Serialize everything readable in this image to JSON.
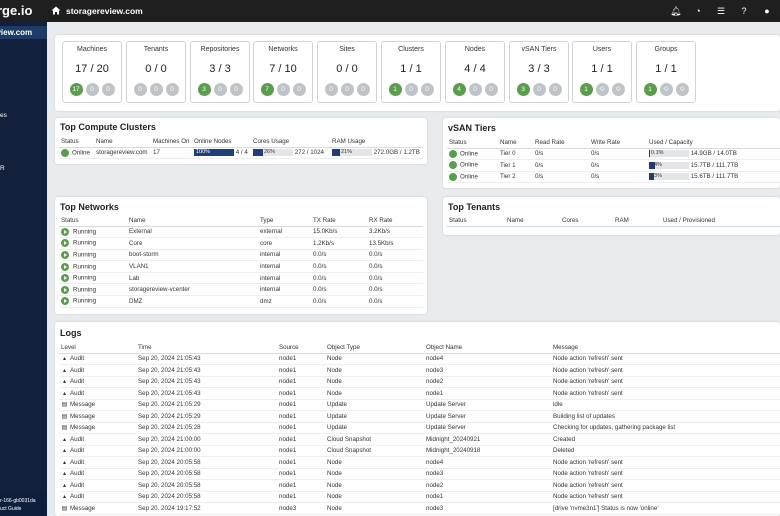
{
  "topbar": {
    "brand": "rge.io",
    "host": "storagereview.com",
    "icons": [
      "bell-icon",
      "rss-icon",
      "list-icon",
      "question-icon",
      "user-icon"
    ]
  },
  "sidebar": {
    "host": "eview.com",
    "frags": [
      "es",
      "R"
    ],
    "footer_line1": "r-166-gb0031da",
    "footer_line2": "uct Guide"
  },
  "stats": [
    {
      "label": "Machines",
      "value": "17 / 20",
      "counts": [
        "17",
        "0",
        "0"
      ]
    },
    {
      "label": "Tenants",
      "value": "0 / 0",
      "counts": [
        "0",
        "0",
        "0"
      ]
    },
    {
      "label": "Repositories",
      "value": "3 / 3",
      "counts": [
        "3",
        "0",
        "0"
      ]
    },
    {
      "label": "Networks",
      "value": "7 / 10",
      "counts": [
        "7",
        "0",
        "0"
      ]
    },
    {
      "label": "Sites",
      "value": "0 / 0",
      "counts": [
        "0",
        "0",
        "0"
      ]
    },
    {
      "label": "Clusters",
      "value": "1 / 1",
      "counts": [
        "1",
        "0",
        "0"
      ]
    },
    {
      "label": "Nodes",
      "value": "4 / 4",
      "counts": [
        "4",
        "0",
        "0"
      ]
    },
    {
      "label": "vSAN Tiers",
      "value": "3 / 3",
      "counts": [
        "3",
        "0",
        "0"
      ]
    },
    {
      "label": "Users",
      "value": "1 / 1",
      "counts": [
        "1",
        "0",
        "0"
      ]
    },
    {
      "label": "Groups",
      "value": "1 / 1",
      "counts": [
        "1",
        "0",
        "0"
      ]
    }
  ],
  "clusters": {
    "title": "Top Compute Clusters",
    "headers": [
      "Status",
      "Name",
      "Machines On",
      "Online Nodes",
      "Cores Usage",
      "RAM Usage"
    ],
    "rows": [
      {
        "status": "Online",
        "name": "storagereview.com",
        "machines_on": "17",
        "online_nodes_pct": "100%",
        "online_nodes_frac": 1.0,
        "online_nodes": "4 / 4",
        "cores_pct": "26%",
        "cores_frac": 0.26,
        "cores": "272 / 1024",
        "ram_pct": "21%",
        "ram_frac": 0.21,
        "ram": "272.0GB / 1.2TB"
      }
    ]
  },
  "vsan": {
    "title": "vSAN Tiers",
    "headers": [
      "Status",
      "Name",
      "Read Rate",
      "Write Rate",
      "Used / Capacity"
    ],
    "rows": [
      {
        "status": "Online",
        "name": "Tier 0",
        "read": "0/s",
        "write": "0/s",
        "pct": "0.1%",
        "frac": 0.001,
        "cap": "14.9GB / 14.0TB"
      },
      {
        "status": "Online",
        "name": "Tier 1",
        "read": "0/s",
        "write": "0/s",
        "pct": "14%",
        "frac": 0.14,
        "cap": "15.7TB / 111.7TB"
      },
      {
        "status": "Online",
        "name": "Tier 2",
        "read": "0/s",
        "write": "0/s",
        "pct": "13%",
        "frac": 0.13,
        "cap": "15.6TB / 111.7TB"
      }
    ]
  },
  "networks": {
    "title": "Top Networks",
    "headers": [
      "Status",
      "Name",
      "Type",
      "TX Rate",
      "RX Rate"
    ],
    "rows": [
      {
        "status": "Running",
        "name": "External",
        "type": "external",
        "tx": "15.0Kb/s",
        "rx": "3.2Kb/s"
      },
      {
        "status": "Running",
        "name": "Core",
        "type": "core",
        "tx": "1.2Kb/s",
        "rx": "13.5Kb/s"
      },
      {
        "status": "Running",
        "name": "boot-storm",
        "type": "internal",
        "tx": "0.0/s",
        "rx": "0.0/s"
      },
      {
        "status": "Running",
        "name": "VLAN1",
        "type": "internal",
        "tx": "0.0/s",
        "rx": "0.0/s"
      },
      {
        "status": "Running",
        "name": "Lab",
        "type": "internal",
        "tx": "0.0/s",
        "rx": "0.0/s"
      },
      {
        "status": "Running",
        "name": "storagereview-vcenter",
        "type": "internal",
        "tx": "0.0/s",
        "rx": "0.0/s"
      },
      {
        "status": "Running",
        "name": "DMZ",
        "type": "dmz",
        "tx": "0.0/s",
        "rx": "0.0/s"
      }
    ]
  },
  "tenants": {
    "title": "Top Tenants",
    "headers": [
      "Status",
      "Name",
      "Cores",
      "RAM",
      "Used / Provisioned"
    ]
  },
  "logs": {
    "title": "Logs",
    "headers": [
      "Level",
      "Time",
      "Source",
      "Object Type",
      "Object Name",
      "Message"
    ],
    "rows": [
      {
        "icon": "user-icon",
        "level": "Audit",
        "time": "Sep 20, 2024 21:05:43",
        "source": "node1",
        "otype": "Node",
        "oname": "node4",
        "msg": "Node action 'refresh' sent"
      },
      {
        "icon": "user-icon",
        "level": "Audit",
        "time": "Sep 20, 2024 21:05:43",
        "source": "node1",
        "otype": "Node",
        "oname": "node3",
        "msg": "Node action 'refresh' sent"
      },
      {
        "icon": "user-icon",
        "level": "Audit",
        "time": "Sep 20, 2024 21:05:43",
        "source": "node1",
        "otype": "Node",
        "oname": "node2",
        "msg": "Node action 'refresh' sent"
      },
      {
        "icon": "user-icon",
        "level": "Audit",
        "time": "Sep 20, 2024 21:05:43",
        "source": "node1",
        "otype": "Node",
        "oname": "node1",
        "msg": "Node action 'refresh' sent"
      },
      {
        "icon": "doc-icon",
        "level": "Message",
        "time": "Sep 20, 2024 21:05:29",
        "source": "node1",
        "otype": "Update",
        "oname": "Update Server",
        "msg": "idle"
      },
      {
        "icon": "doc-icon",
        "level": "Message",
        "time": "Sep 20, 2024 21:05:29",
        "source": "node1",
        "otype": "Update",
        "oname": "Update Server",
        "msg": "Building list of updates"
      },
      {
        "icon": "doc-icon",
        "level": "Message",
        "time": "Sep 20, 2024 21:05:28",
        "source": "node1",
        "otype": "Update",
        "oname": "Update Server",
        "msg": "Checking for updates, gathering package list"
      },
      {
        "icon": "user-icon",
        "level": "Audit",
        "time": "Sep 20, 2024 21:00:00",
        "source": "node1",
        "otype": "Cloud Snapshot",
        "oname": "Midnight_20240921",
        "msg": "Created"
      },
      {
        "icon": "user-icon",
        "level": "Audit",
        "time": "Sep 20, 2024 21:00:00",
        "source": "node1",
        "otype": "Cloud Snapshot",
        "oname": "Midnight_20240918",
        "msg": "Deleted"
      },
      {
        "icon": "user-icon",
        "level": "Audit",
        "time": "Sep 20, 2024 20:05:58",
        "source": "node1",
        "otype": "Node",
        "oname": "node4",
        "msg": "Node action 'refresh' sent"
      },
      {
        "icon": "user-icon",
        "level": "Audit",
        "time": "Sep 20, 2024 20:05:58",
        "source": "node1",
        "otype": "Node",
        "oname": "node3",
        "msg": "Node action 'refresh' sent"
      },
      {
        "icon": "user-icon",
        "level": "Audit",
        "time": "Sep 20, 2024 20:05:58",
        "source": "node1",
        "otype": "Node",
        "oname": "node2",
        "msg": "Node action 'refresh' sent"
      },
      {
        "icon": "user-icon",
        "level": "Audit",
        "time": "Sep 20, 2024 20:05:58",
        "source": "node1",
        "otype": "Node",
        "oname": "node1",
        "msg": "Node action 'refresh' sent"
      },
      {
        "icon": "doc-icon",
        "level": "Message",
        "time": "Sep 20, 2024 19:17:52",
        "source": "node3",
        "otype": "Node",
        "oname": "node3",
        "msg": "[drive 'nvme3n1'] Status is now 'online'"
      }
    ]
  },
  "colors": {
    "green": "#5a9e4d",
    "grey": "#bfc4c9",
    "navy": "#1e3f7a",
    "sidebar": "#13203b",
    "topbar": "#1f1f1f"
  }
}
